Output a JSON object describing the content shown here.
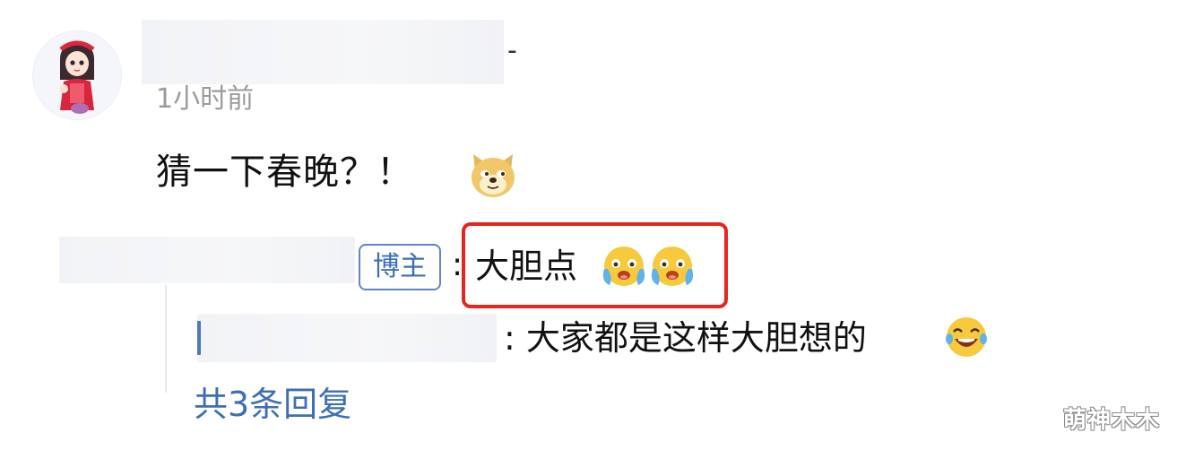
{
  "comment": {
    "username_suffix": "-",
    "timestamp": "1小时前",
    "text": "猜一下春晚？！",
    "emoji": "doge-icon"
  },
  "replies": [
    {
      "badge": "博主",
      "colon": ":",
      "text": "大胆点",
      "emojis": [
        "crying-face-icon",
        "crying-face-icon"
      ],
      "highlight_color": "#e5261f"
    },
    {
      "text": ": 大家都是这样大胆想的",
      "emoji": "laughing-face-icon"
    }
  ],
  "more_replies_label": "共3条回复",
  "watermark": "萌神木木",
  "colors": {
    "link_blue": "#3d6fb6",
    "highlight_red": "#e5261f",
    "timestamp_gray": "#9b9b9b"
  }
}
